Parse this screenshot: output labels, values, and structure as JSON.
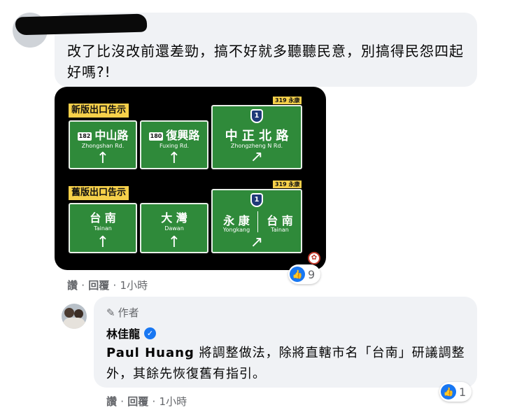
{
  "comment1": {
    "text": "改了比沒改前還差勁，搞不好就多聽聽民意，別搞得民怨四起好嗎?!",
    "reaction_count": "9",
    "actions": {
      "like": "讚",
      "reply": "回覆",
      "time": "1小時",
      "separator": "·"
    }
  },
  "signs": {
    "new_label": "新版出口告示",
    "old_label": "舊版出口告示",
    "new": [
      {
        "route": "182",
        "cn": "中山路",
        "en": "Zhongshan Rd.",
        "arrow": "↑"
      },
      {
        "route": "180",
        "cn": "復興路",
        "en": "Fuxing Rd.",
        "arrow": "↑"
      },
      {
        "tag": "319 永康",
        "shield": "1",
        "cn": "中 正 北 路",
        "en": "Zhongzheng N Rd.",
        "arrow": "↗"
      }
    ],
    "old": [
      {
        "cn": "台 南",
        "en": "Tainan",
        "arrow": "↑"
      },
      {
        "cn": "大 灣",
        "en": "Dawan",
        "arrow": "↑"
      },
      {
        "tag": "319 永康",
        "shield": "1",
        "cn_left": "永 康",
        "en_left": "Yongkang",
        "cn_right": "台 南",
        "en_right": "Tainan",
        "arrow": "↗"
      }
    ]
  },
  "reply": {
    "author_tag": "作者",
    "name": "林佳龍",
    "mention": "Paul Huang",
    "text": " 將調整做法，除將直轄市名「台南」研議調整外，其餘先恢復舊有指引。",
    "reaction_count": "1",
    "actions": {
      "like": "讚",
      "reply": "回覆",
      "time": "1小時",
      "separator": "·"
    }
  },
  "colors": {
    "accent": "#1877f2",
    "bubble": "#f0f2f5",
    "sign_green": "#2f8a3a",
    "label_yellow": "#f6d04a"
  }
}
